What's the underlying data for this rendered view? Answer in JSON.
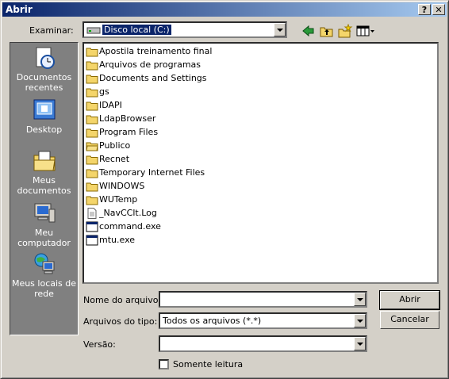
{
  "window": {
    "title": "Abrir",
    "help_btn": "?",
    "close_btn": "✕"
  },
  "toolbar": {
    "look_in_label": "Examinar:",
    "look_in_value": "Disco local (C:)"
  },
  "places": [
    {
      "label": "Documentos recentes"
    },
    {
      "label": "Desktop"
    },
    {
      "label": "Meus documentos"
    },
    {
      "label": "Meu computador"
    },
    {
      "label": "Meus locais de rede"
    }
  ],
  "files": [
    {
      "name": "Apostila treinamento final",
      "type": "folder"
    },
    {
      "name": "Arquivos de programas",
      "type": "folder"
    },
    {
      "name": "Documents and Settings",
      "type": "folder"
    },
    {
      "name": "gs",
      "type": "folder"
    },
    {
      "name": "IDAPI",
      "type": "folder"
    },
    {
      "name": "LdapBrowser",
      "type": "folder"
    },
    {
      "name": "Program Files",
      "type": "folder"
    },
    {
      "name": "Publico",
      "type": "folder-open"
    },
    {
      "name": "Recnet",
      "type": "folder"
    },
    {
      "name": "Temporary Internet Files",
      "type": "folder"
    },
    {
      "name": "WINDOWS",
      "type": "folder"
    },
    {
      "name": "WUTemp",
      "type": "folder"
    },
    {
      "name": "_NavCClt.Log",
      "type": "text-file"
    },
    {
      "name": "command.exe",
      "type": "exe-file"
    },
    {
      "name": "mtu.exe",
      "type": "exe-file"
    }
  ],
  "form": {
    "filename_label": "Nome do arquivo:",
    "filename_value": "",
    "filetype_label": "Arquivos do tipo:",
    "filetype_value": "Todos os arquivos (*.*)",
    "version_label": "Versão:",
    "version_value": "",
    "readonly_label": "Somente leitura",
    "readonly_checked": false
  },
  "buttons": {
    "open": "Abrir",
    "cancel": "Cancelar"
  }
}
